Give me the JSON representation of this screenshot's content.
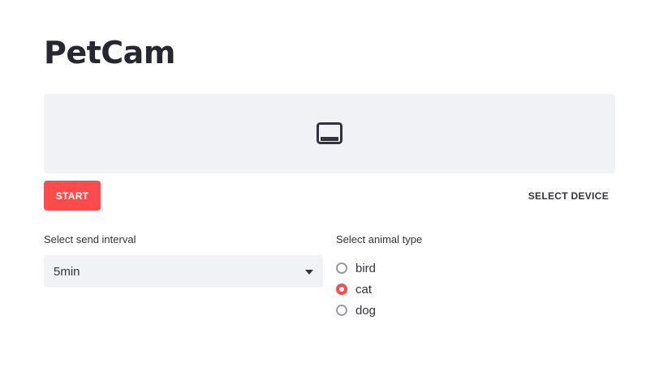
{
  "app": {
    "title": "PetCam"
  },
  "video": {
    "icon": "webcam-icon"
  },
  "controls": {
    "start_label": "START",
    "select_device_label": "SELECT DEVICE"
  },
  "interval": {
    "label": "Select send interval",
    "selected": "5min"
  },
  "animal": {
    "label": "Select animal type",
    "options": [
      {
        "label": "bird",
        "checked": false
      },
      {
        "label": "cat",
        "checked": true
      },
      {
        "label": "dog",
        "checked": false
      }
    ]
  },
  "colors": {
    "accent": "#ff4b4b",
    "panel_bg": "#f0f2f6",
    "text": "#31333f"
  }
}
